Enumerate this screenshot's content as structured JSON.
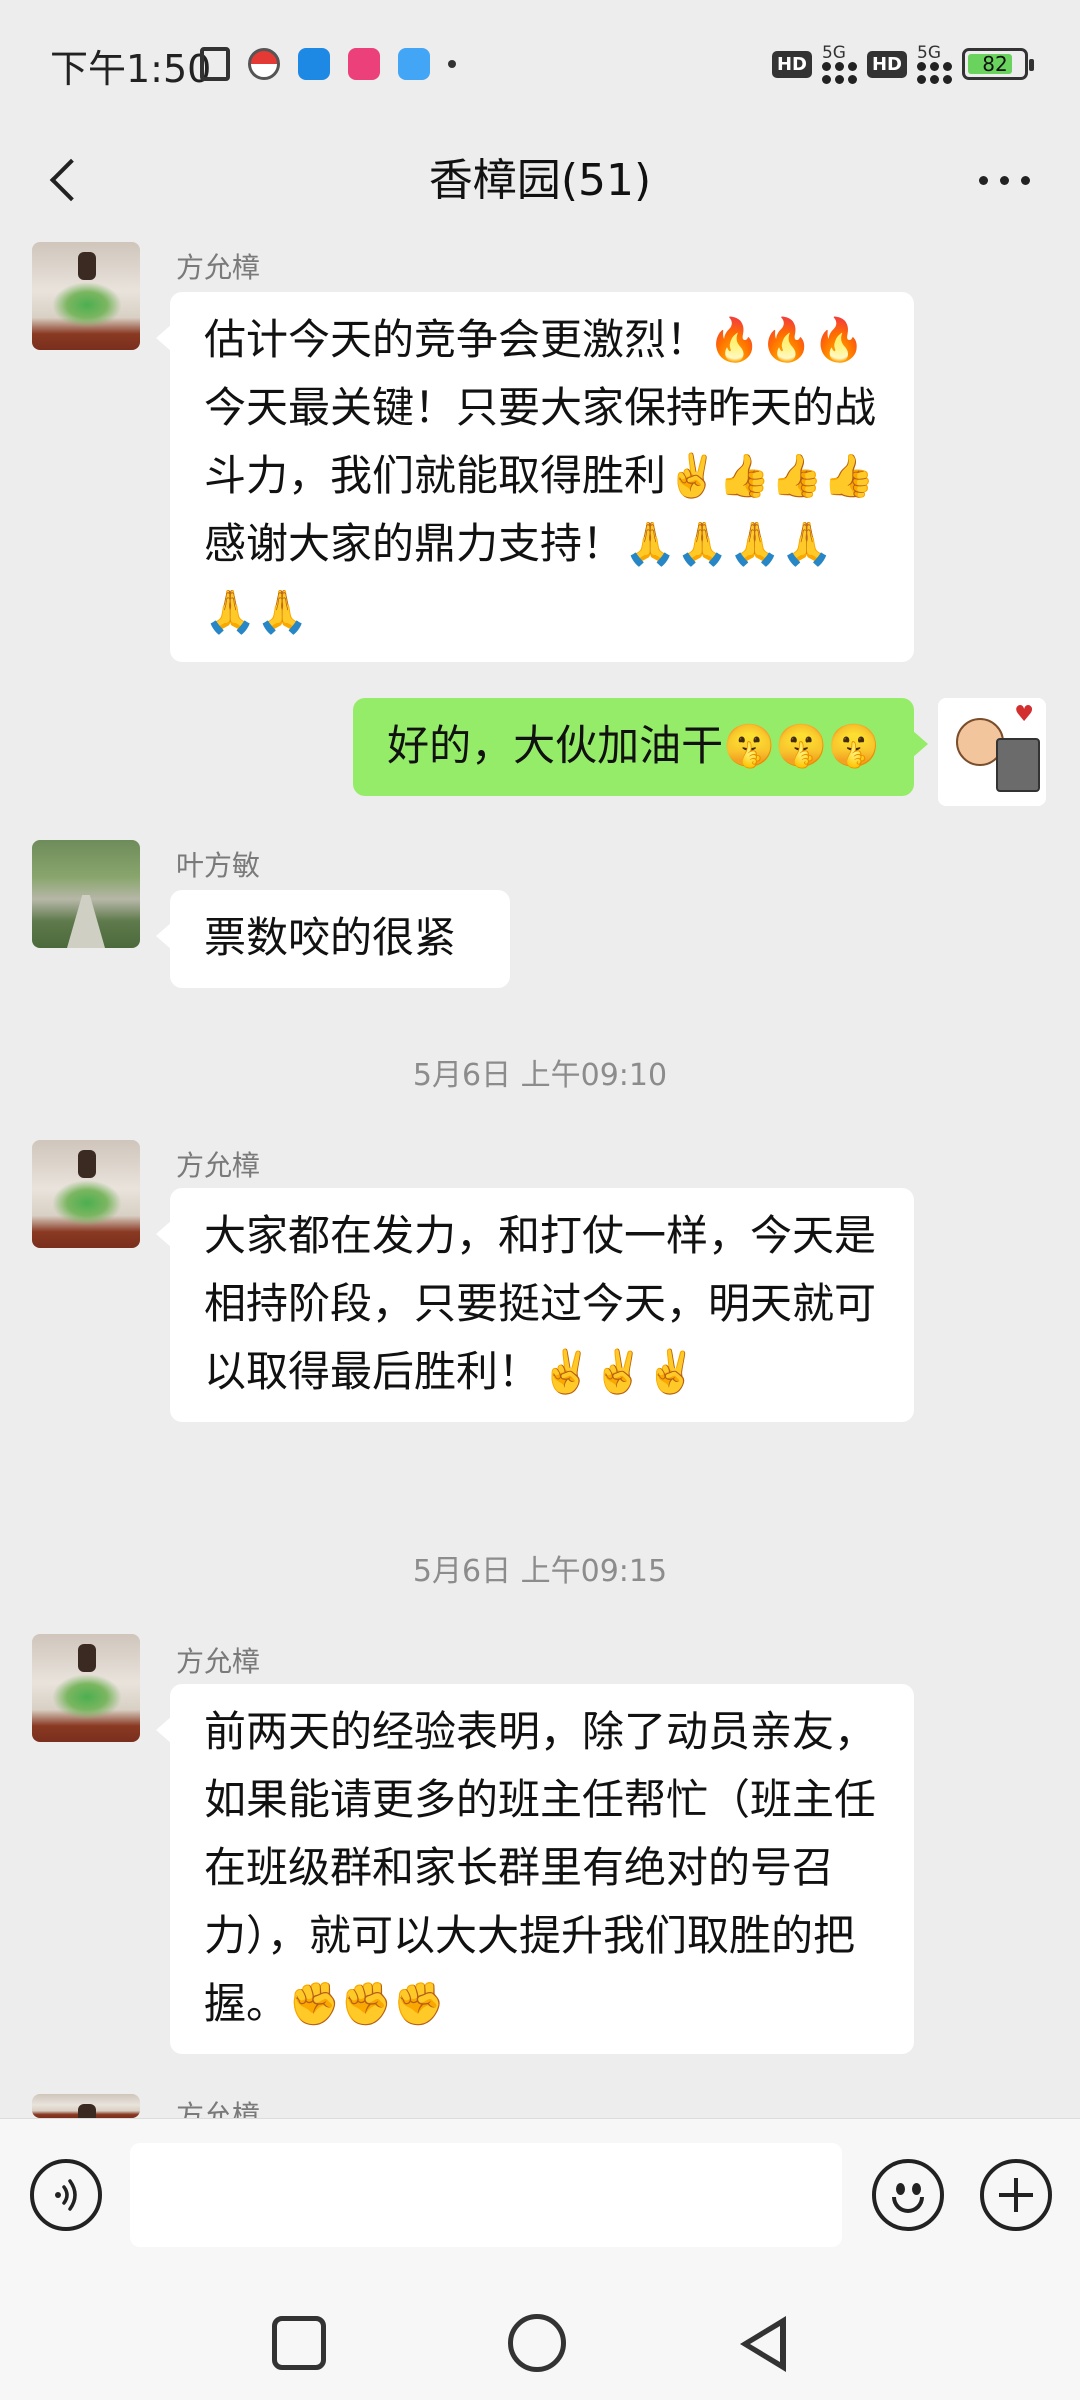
{
  "status_bar": {
    "time": "下午1:50",
    "network_1": "5G",
    "network_2": "5G",
    "hd_1": "HD",
    "hd_2": "HD",
    "battery": "82"
  },
  "header": {
    "title": "香樟园(51)"
  },
  "messages": [
    {
      "sender": "方允樟",
      "text": "估计今天的竞争会更激烈！🔥🔥🔥今天最关键！只要大家保持昨天的战斗力，我们就能取得胜利✌️👍👍👍感谢大家的鼎力支持！🙏🙏🙏🙏🙏🙏"
    },
    {
      "sender": "",
      "text": "好的，大伙加油干🤫🤫🤫",
      "self": true
    },
    {
      "sender": "叶方敏",
      "text": "票数咬的很紧"
    },
    {
      "timestamp": "5月6日 上午09:10"
    },
    {
      "sender": "方允樟",
      "text": "大家都在发力，和打仗一样，今天是相持阶段，只要挺过今天，明天就可以取得最后胜利！✌️✌️✌️"
    },
    {
      "timestamp": "5月6日 上午09:15"
    },
    {
      "sender": "方允樟",
      "text": "前两天的经验表明，除了动员亲友，如果能请更多的班主任帮忙（班主任在班级群和家长群里有绝对的号召力），就可以大大提升我们取胜的把握。✊✊✊"
    },
    {
      "sender": "方允樟"
    }
  ],
  "input": {
    "value": ""
  },
  "colors": {
    "background": "#ededed",
    "self_bubble": "#95ec69",
    "other_bubble": "#ffffff"
  }
}
